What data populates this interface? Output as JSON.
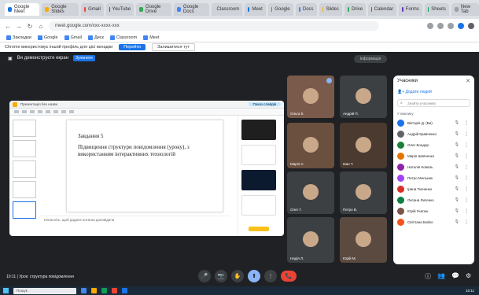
{
  "browser": {
    "tabs": [
      "Google Meet",
      "Google Slides",
      "Gmail",
      "YouTube",
      "Google Drive",
      "Google Docs",
      "Classroom",
      "Meet",
      "Google",
      "Docs",
      "Slides",
      "Drive",
      "Calendar",
      "Forms",
      "Sheets",
      "New Tab"
    ],
    "tab_colors": [
      "#1a73e8",
      "#f9ab00",
      "#ea4335",
      "#ff0000",
      "#34a853",
      "#4285f4",
      "#188038",
      "#1a73e8",
      "#4285f4",
      "#4285f4",
      "#f9ab00",
      "#34a853",
      "#1a73e8",
      "#673ab7",
      "#0f9d58",
      "#9aa0a6"
    ],
    "url": "meet.google.com/xxx-xxxx-xxx",
    "bookmarks": [
      "Закладки",
      "Google",
      "Gmail",
      "Диск",
      "Classroom",
      "Meet"
    ],
    "infobar_text": "Chrome використовує інший профіль для цієї вкладки",
    "infobar_primary": "Перейти",
    "infobar_secondary": "Залишитися тут"
  },
  "meet": {
    "presenter_label": "Ви демонструєте екран",
    "presenter_badge": "Зупинити",
    "top_pill": "Інформація",
    "meeting_title": "10:11 | Урок: структура повідомлення",
    "controls": [
      "🎤",
      "📷",
      "✋",
      "⬆",
      "⋮",
      "📞"
    ]
  },
  "presentation": {
    "toolbar_title": "Презентація без назви",
    "share_label": "Показ слайдів",
    "slide_heading": "Завдання 5",
    "slide_body": "Підвищення структури повідомлення (уроку), з використанням інтерактивних технологій",
    "notes_placeholder": "Натисніть, щоб додати нотатки доповідача"
  },
  "tiles": [
    {
      "name": "Ольга К.",
      "color": "#7a5a4a"
    },
    {
      "name": "Андрій П.",
      "color": "#3c4043"
    },
    {
      "name": "Марія С.",
      "color": "#6b4f3f"
    },
    {
      "name": "Іван Т.",
      "color": "#4a3a30"
    },
    {
      "name": "Олег Г.",
      "color": "#3c4043"
    },
    {
      "name": "Петро В.",
      "color": "#3c4043"
    },
    {
      "name": "Надія Л.",
      "color": "#3c4043"
    },
    {
      "name": "Юрій М.",
      "color": "#5a4a40"
    }
  ],
  "participants_panel": {
    "title": "Учасники",
    "add_people": "Додати людей",
    "search_placeholder": "Знайти учасників",
    "in_call_label": "У виклику",
    "people": [
      {
        "name": "Вікторія Д. (Ви)",
        "color": "#1a73e8"
      },
      {
        "name": "Андрій Кравченко",
        "color": "#5f6368"
      },
      {
        "name": "Олег Бондар",
        "color": "#188038"
      },
      {
        "name": "Марія Шевченко",
        "color": "#e37400"
      },
      {
        "name": "Наталія Коваль",
        "color": "#8e24aa"
      },
      {
        "name": "Петро Мельник",
        "color": "#a142f4"
      },
      {
        "name": "Ірина Ткаченко",
        "color": "#d93025"
      },
      {
        "name": "Оксана Лисенко",
        "color": "#0b8043"
      },
      {
        "name": "Юрій Гнатюк",
        "color": "#795548"
      },
      {
        "name": "Світлана Бойко",
        "color": "#f4511e"
      }
    ]
  },
  "taskbar": {
    "search_placeholder": "Пошук",
    "time": "10:11"
  }
}
